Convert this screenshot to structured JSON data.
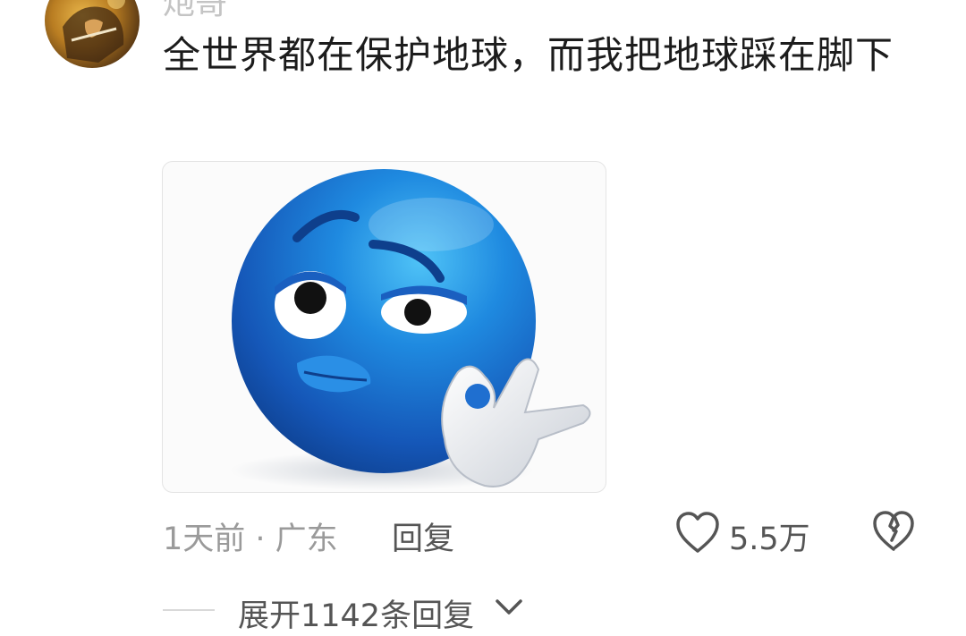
{
  "comment": {
    "username": "炮哥",
    "text": "全世界都在保护地球，而我把地球踩在脚下",
    "image_icon": "blue-smiley-ok-hand",
    "time": "1天前",
    "separator": "·",
    "location": "广东",
    "time_location": "1天前 · 广东",
    "reply_label": "回复",
    "like_count": "5.5万",
    "like_icon": "heart-outline-icon",
    "dislike_icon": "broken-heart-icon"
  },
  "replies": {
    "expand_label": "展开1142条回复",
    "expand_icon": "chevron-down-icon"
  },
  "colors": {
    "text_primary": "#1c1c1c",
    "text_secondary": "#9a9a9a",
    "text_action": "#555555",
    "emoji_blue": "#1f6fd0"
  }
}
